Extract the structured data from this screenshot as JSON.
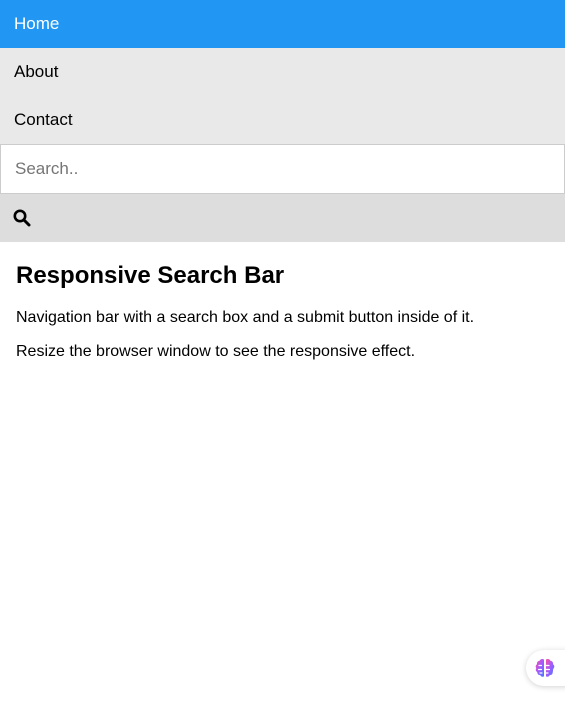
{
  "nav": {
    "items": [
      {
        "label": "Home",
        "active": true
      },
      {
        "label": "About",
        "active": false
      },
      {
        "label": "Contact",
        "active": false
      }
    ],
    "active_color": "#2196f3",
    "background_color": "#e9e9e9"
  },
  "search": {
    "placeholder": "Search..",
    "value": "",
    "button_icon": "search-icon"
  },
  "content": {
    "title": "Responsive Search Bar",
    "paragraphs": [
      "Navigation bar with a search box and a submit button inside of it.",
      "Resize the browser window to see the responsive effect."
    ]
  },
  "widget": {
    "icon": "brain-icon"
  }
}
